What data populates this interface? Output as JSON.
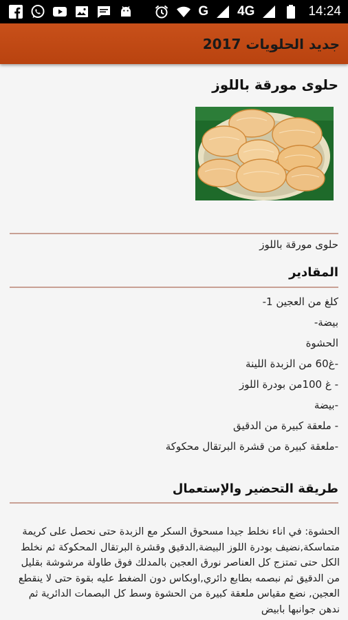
{
  "status_bar": {
    "left_icons": [
      "facebook-icon",
      "whatsapp-icon",
      "youtube-icon",
      "image-icon",
      "messages-icon",
      "android-icon"
    ],
    "network_label": "G",
    "network_label_2": "4G",
    "time": "14:24"
  },
  "app_bar": {
    "title": "جديد الحلويات 2017"
  },
  "article": {
    "title": "حلوى مورقة باللوز",
    "subtitle": "حلوى مورقة باللوز",
    "ingredients_heading": "المقادير",
    "ingredients": [
      "كلغ من العجين 1-",
      "بيضة-",
      "الحشوة",
      "-غ60 من الزبدة اللينة",
      "- غ 100من بودرة اللوز",
      "-بيضة",
      "- ملعقة كبيرة من الدقيق",
      "-ملعقة كبيرة من قشرة البرتقال محكوكة"
    ],
    "preparation_heading": "طريقة التحضير والإستعمال",
    "preparation_text": "الحشوة: في اناء نخلط جيدا مسحوق السكر مع الزبدة حتى نحصل على كريمة متماسكة,نضيف بودرة اللوز البيضة,الدقيق وقشرة البرتقال المحكوكة ثم نخلط الكل حتى تمتزج كل العناصر نورق العجين بالمدلك فوق طاولة مرشوشة بقليل من الدقيق ثم نبصمه بطابع دائري,اوبكاس دون الضغط عليه بقوة حتى لا ينقطع العجين, نضع مقياس ملعقة كبيرة من الحشوة وسط كل البصمات الدائرية ثم ندهن جوانبها بابيض"
  },
  "colors": {
    "app_bar": "#c04a14",
    "divider": "#c8a094",
    "background": "#f5f5f5"
  }
}
